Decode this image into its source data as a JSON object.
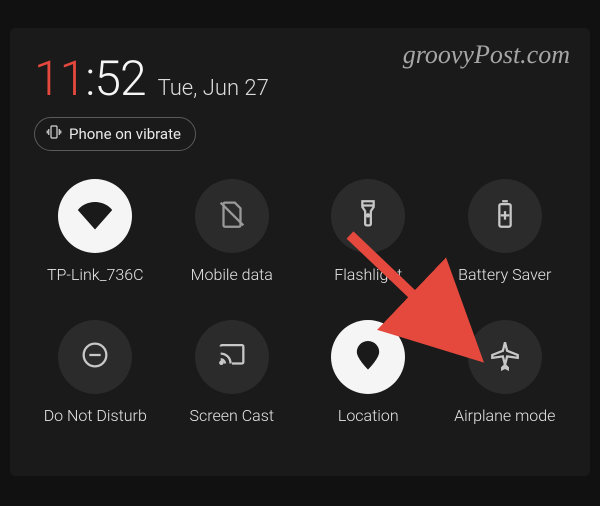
{
  "watermark": "groovyPost.com",
  "status": {
    "time_hours": "11",
    "time_sep": ":",
    "time_minutes": "52",
    "date": "Tue, Jun 27",
    "ringer_label": "Phone on vibrate"
  },
  "tiles": [
    {
      "id": "wifi",
      "label": "TP-Link_736C",
      "active": true
    },
    {
      "id": "mobile-data",
      "label": "Mobile data",
      "active": false
    },
    {
      "id": "flashlight",
      "label": "Flashlight",
      "active": false
    },
    {
      "id": "battery-saver",
      "label": "Battery Saver",
      "active": false
    },
    {
      "id": "dnd",
      "label": "Do Not Disturb",
      "active": false
    },
    {
      "id": "screen-cast",
      "label": "Screen Cast",
      "active": false
    },
    {
      "id": "location",
      "label": "Location",
      "active": true
    },
    {
      "id": "airplane",
      "label": "Airplane mode",
      "active": false
    }
  ],
  "annotation": {
    "arrow_color": "#e5493d",
    "arrow_target": "airplane"
  }
}
